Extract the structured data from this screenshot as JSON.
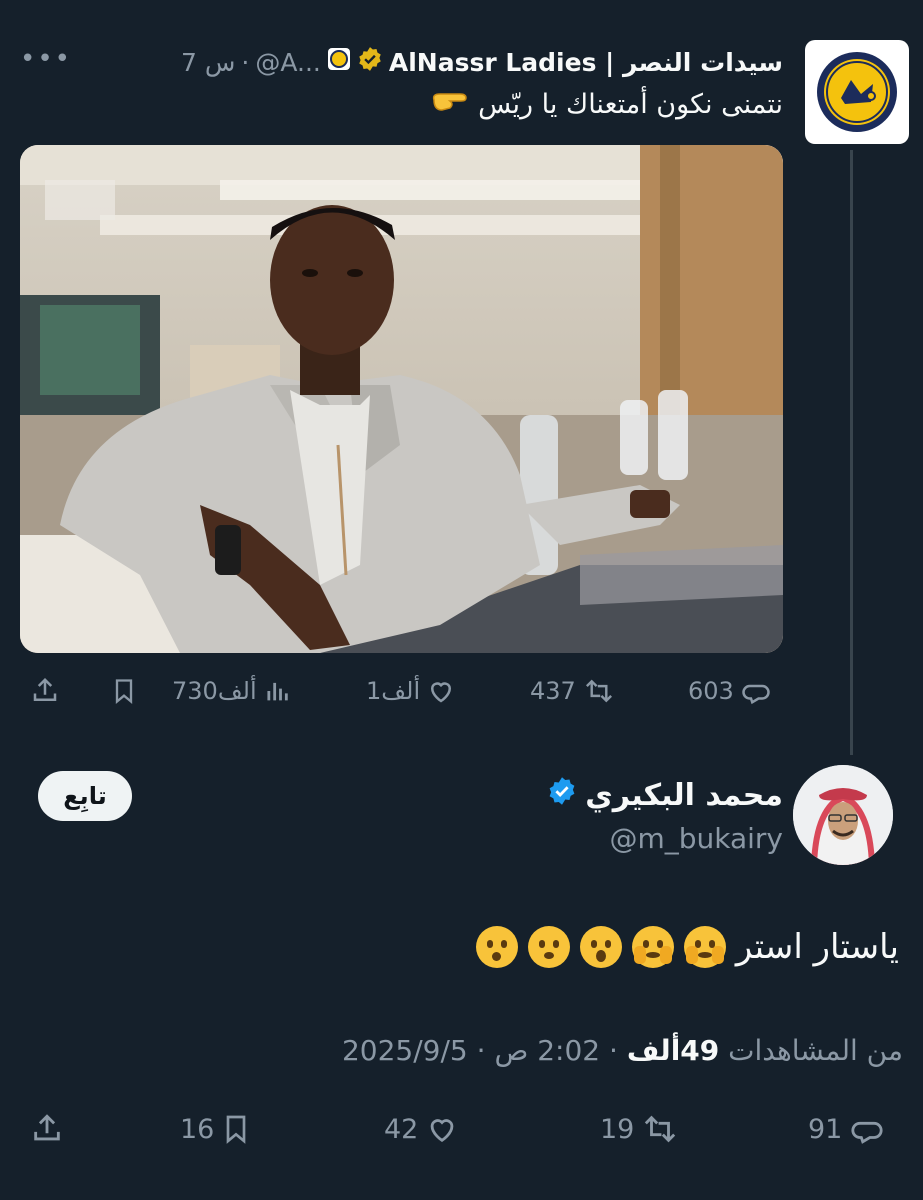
{
  "parent": {
    "name": "AlNassr Ladies | سيدات النصر",
    "handle": "@A...",
    "time": "7 س",
    "separator": "·",
    "text": "نتمنى نكون أمتعناك يا ريّس",
    "logo_text_top": "NASSR",
    "logo_text_bottom": "RIYADH 1955",
    "actions": {
      "replies": "603",
      "retweets": "437",
      "likes": "1ألف",
      "views": "730ألف"
    }
  },
  "reply": {
    "name": "محمد البكيري",
    "handle": "@m_bukairy",
    "follow_label": "تابِع",
    "text": "ياستار استر",
    "emojis": [
      "hushed-face",
      "frowning-open-mouth",
      "astonished-face",
      "face-with-peeking-eye",
      "face-with-peeking-eye"
    ],
    "date": "2025/9/5",
    "time": "2:02 ص",
    "views_count": "49ألف",
    "views_label": "من المشاهدات",
    "actions": {
      "replies": "91",
      "retweets": "19",
      "likes": "42",
      "bookmarks": "16"
    }
  },
  "colors": {
    "background": "#15202b",
    "text": "#f7f9f9",
    "muted": "#8b98a5",
    "verified_blue": "#1d9bf0",
    "verified_gold": "#e2b719"
  }
}
